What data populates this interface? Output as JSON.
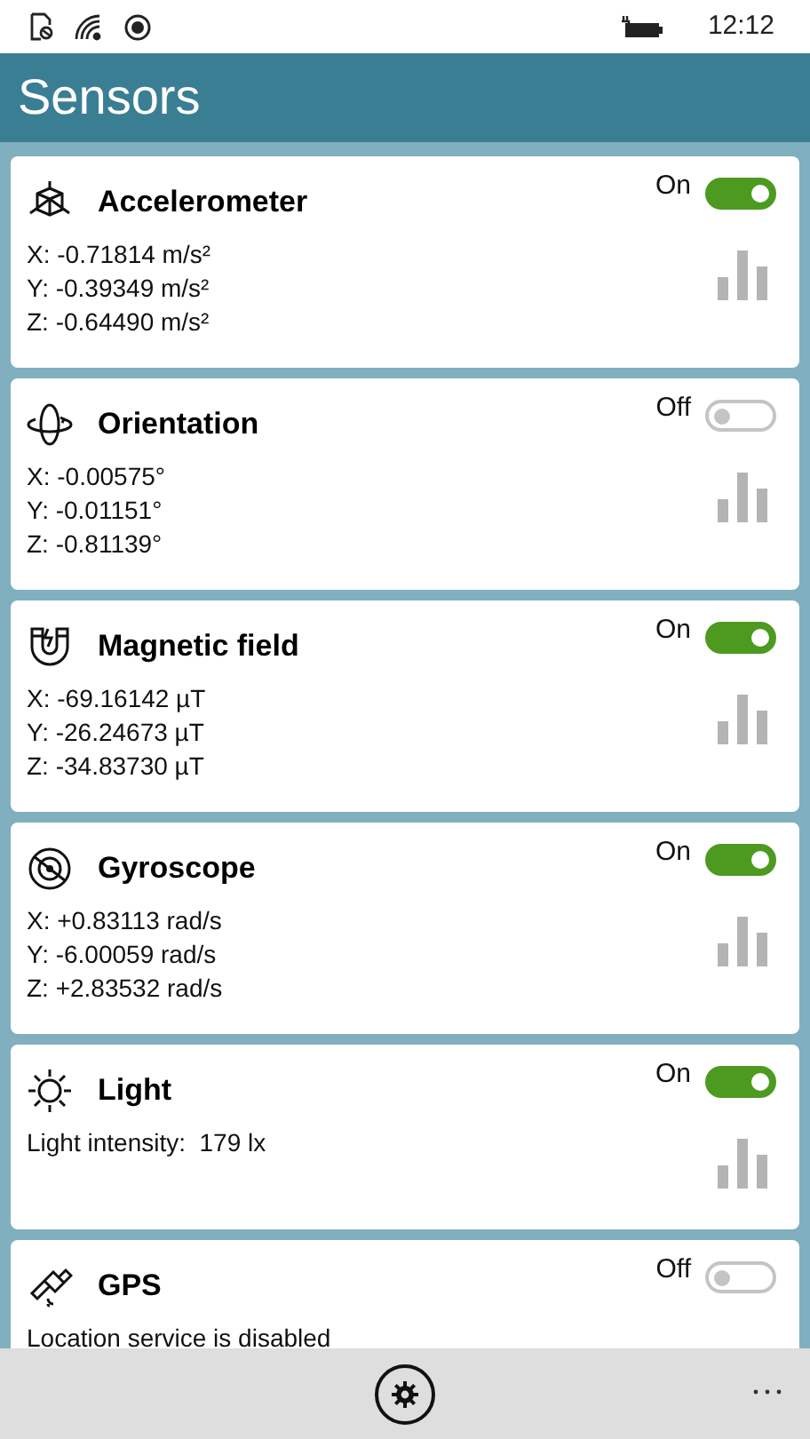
{
  "status_bar": {
    "time": "12:12"
  },
  "header": {
    "title": "Sensors"
  },
  "sensors": [
    {
      "kind": "cube",
      "name": "Accelerometer",
      "toggle_label": "On",
      "on": true,
      "readings": [
        "X: -0.71814 m/s²",
        "Y: -0.39349 m/s²",
        "Z: -0.64490 m/s²"
      ],
      "graph_button": true
    },
    {
      "kind": "orbit",
      "name": "Orientation",
      "toggle_label": "Off",
      "on": false,
      "readings": [
        "X: -0.00575°",
        "Y: -0.01151°",
        "Z: -0.81139°"
      ],
      "graph_button": true
    },
    {
      "kind": "magnet",
      "name": "Magnetic field",
      "toggle_label": "On",
      "on": true,
      "readings": [
        "X: -69.16142 µT",
        "Y: -26.24673 µT",
        "Z: -34.83730 µT"
      ],
      "graph_button": true
    },
    {
      "kind": "gyro",
      "name": "Gyroscope",
      "toggle_label": "On",
      "on": true,
      "readings": [
        "X: +0.83113 rad/s",
        "Y: -6.00059 rad/s",
        "Z: +2.83532 rad/s"
      ],
      "graph_button": true
    },
    {
      "kind": "sun",
      "name": "Light",
      "toggle_label": "On",
      "on": true,
      "readings": [
        "Light intensity:  179 lx"
      ],
      "graph_button": true
    },
    {
      "kind": "satellite",
      "name": "GPS",
      "toggle_label": "Off",
      "on": false,
      "readings": [
        "Location service is disabled"
      ],
      "graph_button": false
    }
  ]
}
